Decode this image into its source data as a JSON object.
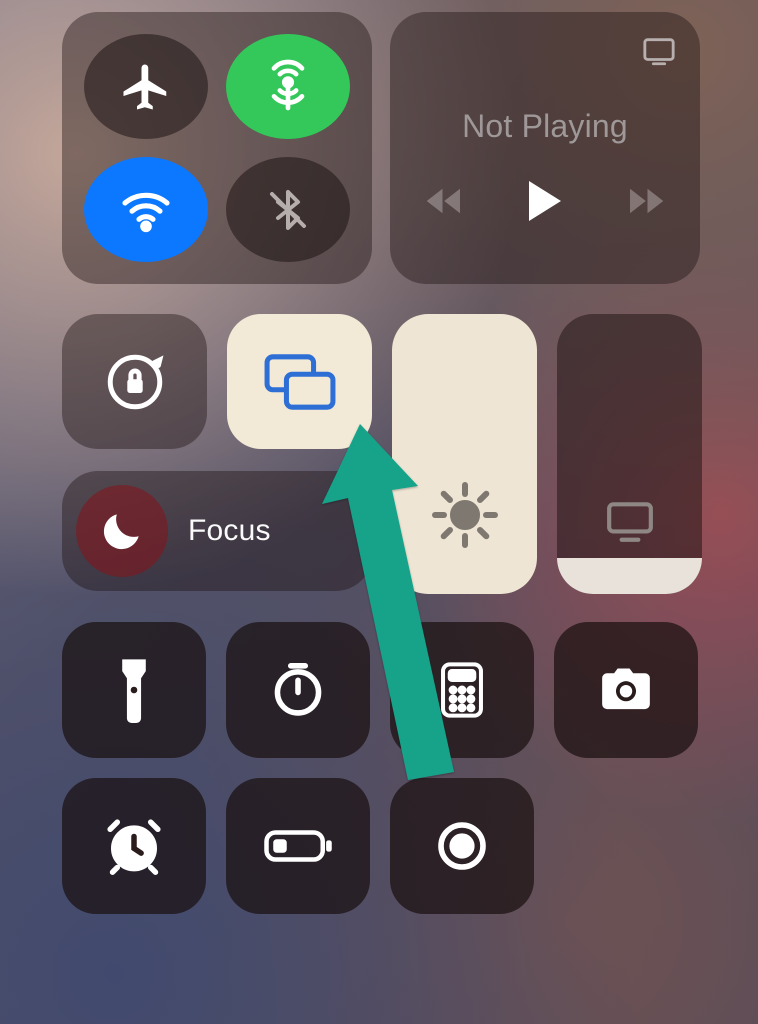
{
  "connectivity": {
    "airplane": {
      "active": false
    },
    "cellular": {
      "active": true
    },
    "wifi": {
      "active": true
    },
    "bluetooth": {
      "active": false
    }
  },
  "media": {
    "title": "Not Playing"
  },
  "focus": {
    "label": "Focus",
    "active": false
  },
  "sliders": {
    "brightness": {
      "percent": 100
    },
    "volume": {
      "percent": 13
    }
  },
  "tiles": [
    {
      "name": "flashlight"
    },
    {
      "name": "timer"
    },
    {
      "name": "calculator"
    },
    {
      "name": "camera"
    },
    {
      "name": "alarm"
    },
    {
      "name": "low-power"
    },
    {
      "name": "screen-record"
    }
  ],
  "colors": {
    "green": "#34c759",
    "blue": "#0b78ff",
    "highlight": "#f3e9d7",
    "arrow": "#19a58b"
  },
  "orientation_lock": {
    "active": false
  },
  "screen_mirroring": {
    "active": true
  }
}
